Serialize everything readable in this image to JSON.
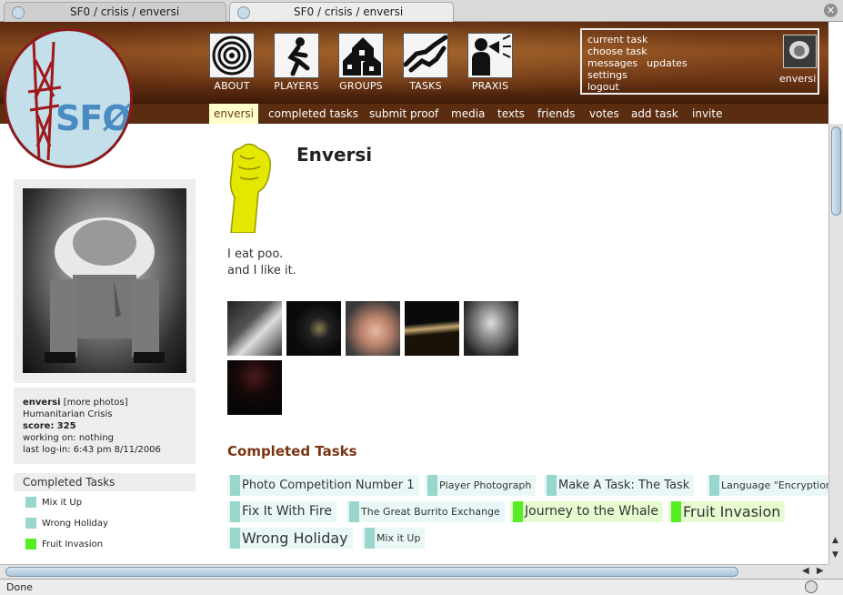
{
  "browser": {
    "tabs": [
      {
        "label": "SF0 / crisis / enversi",
        "active": false
      },
      {
        "label": "SF0 / crisis / enversi",
        "active": true
      }
    ],
    "close_glyph": "✕",
    "status_text": "Done"
  },
  "header": {
    "logo_text": "SFØ",
    "nav": [
      {
        "label": "ABOUT",
        "icon": "target-icon"
      },
      {
        "label": "PLAYERS",
        "icon": "running-man-icon"
      },
      {
        "label": "GROUPS",
        "icon": "houses-icon"
      },
      {
        "label": "TASKS",
        "icon": "handshake-icon"
      },
      {
        "label": "PRAXIS",
        "icon": "megaphone-icon"
      }
    ],
    "user_links": {
      "current_task": "current task",
      "choose_task": "choose task",
      "messages": "messages",
      "updates": "updates",
      "settings": "settings",
      "logout": "logout"
    },
    "username": "enversi"
  },
  "menu": [
    {
      "label": "enversi",
      "active": true
    },
    {
      "label": "completed tasks",
      "active": false
    },
    {
      "label": "submit proof",
      "active": false
    },
    {
      "label": "media",
      "active": false
    },
    {
      "label": "texts",
      "active": false
    },
    {
      "label": "friends",
      "active": false
    },
    {
      "label": "votes",
      "active": false
    },
    {
      "label": "add task",
      "active": false
    },
    {
      "label": "invite",
      "active": false
    }
  ],
  "sidebar": {
    "name": "enversi",
    "more_photos": "[more photos]",
    "group": "Humanitarian Crisis",
    "score_label": "score:",
    "score_value": "325",
    "working_on": "working on: nothing",
    "last_login": "last log-in: 6:43 pm 8/11/2006",
    "completed_title": "Completed Tasks",
    "completed": [
      {
        "label": "Mix it Up",
        "color": "#99d6cc"
      },
      {
        "label": "Wrong Holiday",
        "color": "#99d6cc"
      },
      {
        "label": "Fruit Invasion",
        "color": "#55ee22"
      }
    ]
  },
  "profile": {
    "name": "Enversi",
    "bio_line1": "I eat poo.",
    "bio_line2": "and I like it."
  },
  "completed_tasks": {
    "title": "Completed Tasks",
    "chips": [
      {
        "label": "Photo Competition Number 1",
        "color": "#99d6cc"
      },
      {
        "label": "Player Photograph",
        "color": "#99d6cc"
      },
      {
        "label": "Make A Task: The Task",
        "color": "#99d6cc"
      },
      {
        "label": "Language \"Encryption",
        "color": "#99d6cc"
      },
      {
        "label": "Fix It With Fire",
        "color": "#99d6cc"
      },
      {
        "label": "The Great Burrito Exchange",
        "color": "#99d6cc"
      },
      {
        "label": "Journey to the Whale",
        "color": "#55ee22"
      },
      {
        "label": "Fruit Invasion",
        "color": "#55ee22"
      },
      {
        "label": "Wrong Holiday",
        "color": "#99d6cc"
      },
      {
        "label": "Mix it Up",
        "color": "#99d6cc"
      }
    ]
  },
  "colors": {
    "menu_bg": "#5a2c10",
    "heading": "#7a3412",
    "chip_teal": "#99d6cc",
    "chip_green": "#55ee22"
  }
}
